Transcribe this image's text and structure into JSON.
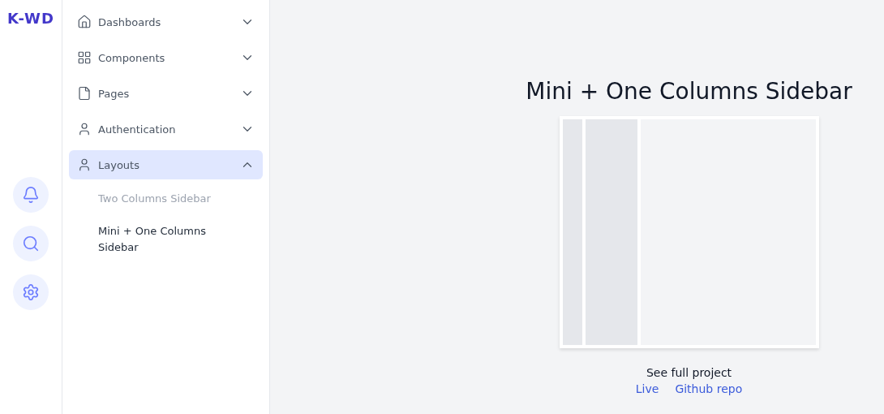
{
  "logo": "K-WD",
  "mini_sidebar": {
    "buttons": [
      {
        "kind": "bell"
      },
      {
        "kind": "search"
      },
      {
        "kind": "settings"
      }
    ]
  },
  "sidebar": {
    "items": [
      {
        "label": "Dashboards",
        "kind": "home",
        "expanded": false,
        "selected": false
      },
      {
        "label": "Components",
        "kind": "grid",
        "expanded": false,
        "selected": false
      },
      {
        "label": "Pages",
        "kind": "file",
        "expanded": false,
        "selected": false
      },
      {
        "label": "Authentication",
        "kind": "user",
        "expanded": false,
        "selected": false
      },
      {
        "label": "Layouts",
        "kind": "user",
        "expanded": true,
        "selected": true,
        "children": [
          {
            "label": "Two Columns Sidebar",
            "selected": false
          },
          {
            "label": "Mini + One Columns Sidebar",
            "selected": true
          }
        ]
      }
    ]
  },
  "main": {
    "title": "Mini + One Columns Sidebar",
    "caption": "See full project",
    "links": [
      "Live",
      "Github repo"
    ]
  }
}
